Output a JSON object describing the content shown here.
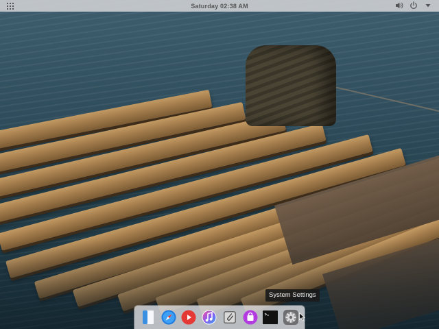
{
  "top_panel": {
    "clock": "Saturday 02:38 AM",
    "apps_icon": "apps-grid-icon",
    "tray": [
      {
        "name": "volume-icon"
      },
      {
        "name": "power-icon"
      },
      {
        "name": "chevron-down-icon"
      }
    ]
  },
  "dock": {
    "items": [
      {
        "name": "files-icon",
        "color": "#3b8fe0"
      },
      {
        "name": "safari-browser-icon",
        "color": "#1e7be0"
      },
      {
        "name": "youtube-icon",
        "color": "#e53935"
      },
      {
        "name": "itunes-music-icon",
        "color": "#8a5cf0"
      },
      {
        "name": "clipboard-paperclip-icon",
        "color": "#6b6b6b"
      },
      {
        "name": "app-store-bag-icon",
        "color": "#b33ce0"
      },
      {
        "name": "terminal-icon",
        "color": "#111111"
      },
      {
        "name": "system-settings-icon",
        "color": "#8a8a8a"
      }
    ]
  },
  "tooltip": {
    "text": "System Settings"
  },
  "colors": {
    "panel_bg": "#d4d4d6",
    "dock_bg": "#e8e8ea",
    "tooltip_bg": "#191919"
  }
}
